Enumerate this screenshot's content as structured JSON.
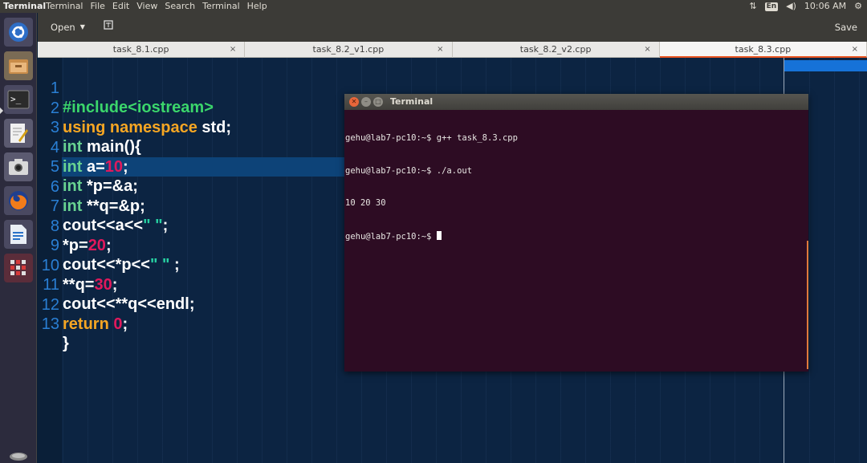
{
  "top_panel": {
    "app_title": "Terminal",
    "menus": [
      "Terminal",
      "File",
      "Edit",
      "View",
      "Search",
      "Terminal",
      "Help"
    ],
    "keyboard_layout": "En",
    "time": "10:06 AM"
  },
  "launcher": {
    "items": [
      "ubuntu-dash-icon",
      "files-icon",
      "terminal-icon",
      "text-editor-icon",
      "screenshot-icon",
      "firefox-icon",
      "writer-icon",
      "app-grid-icon",
      "trash-icon"
    ]
  },
  "toolbar": {
    "open_label": "Open",
    "save_label": "Save"
  },
  "tabs": [
    {
      "label": "task_8.1.cpp",
      "close": "×"
    },
    {
      "label": "task_8.2_v1.cpp",
      "close": "×"
    },
    {
      "label": "task_8.2_v2.cpp",
      "close": "×"
    },
    {
      "label": "task_8.3.cpp",
      "close": "×"
    }
  ],
  "code": {
    "line_numbers": [
      "1",
      "2",
      "3",
      "4",
      "5",
      "6",
      "7",
      "8",
      "9",
      "10",
      "11",
      "12",
      "13"
    ],
    "l1": {
      "a": "#include",
      "b": "<iostream>"
    },
    "l2": {
      "a": "using namespace",
      "b": " std;"
    },
    "l3": {
      "a": "int",
      "b": " main(){"
    },
    "l4": {
      "a": "int",
      "b": " a=",
      "c": "10",
      "d": ";"
    },
    "l5": {
      "a": "int",
      "b": " *p=&a;"
    },
    "l6": {
      "a": "int",
      "b": " **q=&p;"
    },
    "l7": {
      "a": "cout<<a<<",
      "b": "\" \"",
      "c": ";"
    },
    "l8": {
      "a": "*p=",
      "b": "20",
      "c": ";"
    },
    "l9": {
      "a": "cout<<*p<<",
      "b": "\" \"",
      "c": " ;"
    },
    "l10": {
      "a": "**q=",
      "b": "30",
      "c": ";"
    },
    "l11": {
      "a": "cout<<**q<<endl;"
    },
    "l12": {
      "a": "return",
      "b": " ",
      "c": "0",
      "d": ";"
    },
    "l13": {
      "a": "}"
    }
  },
  "terminal": {
    "title": "Terminal",
    "lines": [
      "gehu@lab7-pc10:~$ g++ task_8.3.cpp",
      "gehu@lab7-pc10:~$ ./a.out",
      "10 20 30"
    ],
    "prompt": "gehu@lab7-pc10:~$ "
  }
}
